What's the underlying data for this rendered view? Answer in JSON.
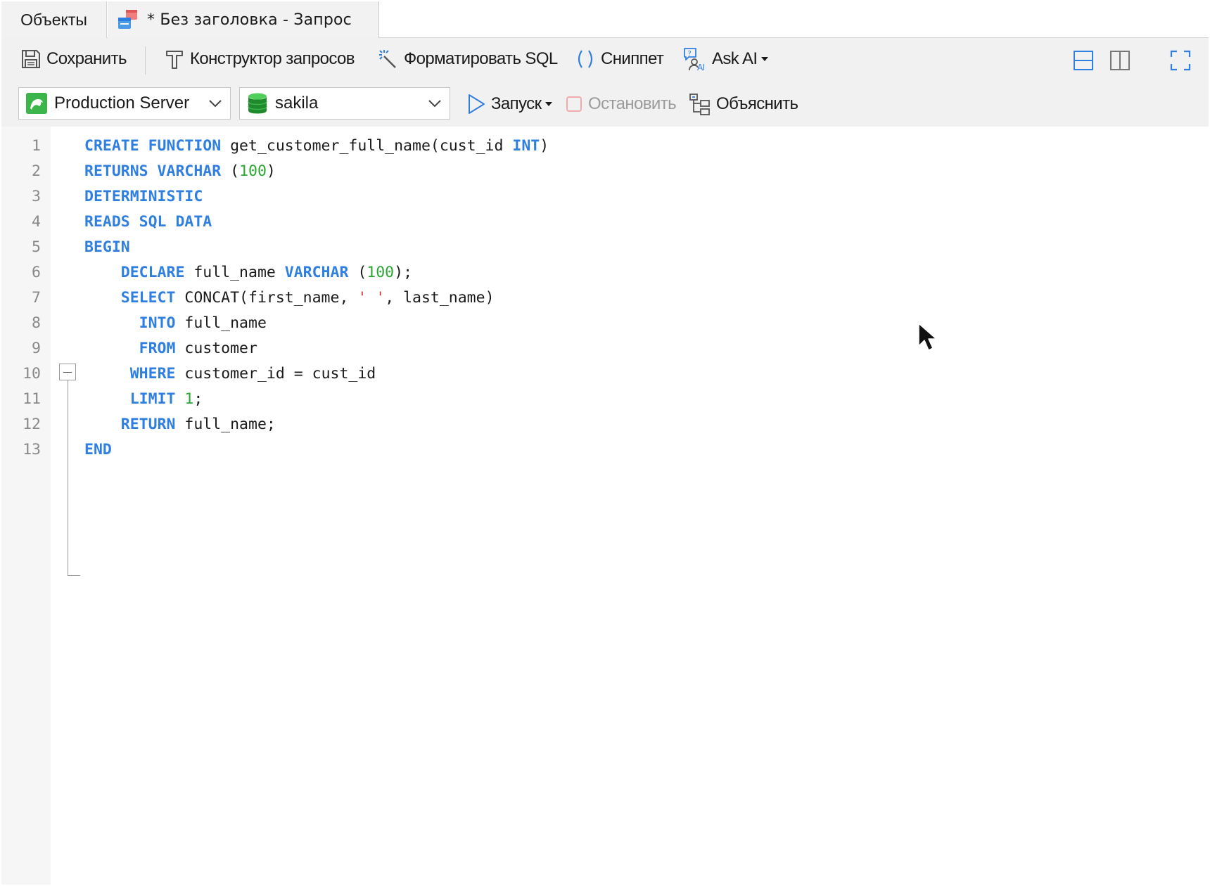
{
  "tabs": {
    "objects_label": "Объекты",
    "query_label": "* Без заголовка - Запрос"
  },
  "toolbar": {
    "save_label": "Сохранить",
    "query_builder_label": "Конструктор запросов",
    "format_sql_label": "Форматировать SQL",
    "snippet_label": "Сниппет",
    "ask_ai_label": "Ask AI",
    "run_label": "Запуск",
    "stop_label": "Остановить",
    "explain_label": "Объяснить"
  },
  "connection": {
    "selected": "Production Server"
  },
  "database": {
    "selected": "sakila"
  },
  "colors": {
    "keyword": "#2f7fe0",
    "number": "#2aa830",
    "string": "#e03a3a",
    "accent": "#2f7fe0"
  },
  "editor": {
    "line_numbers": [
      "1",
      "2",
      "3",
      "4",
      "5",
      "6",
      "7",
      "8",
      "9",
      "10",
      "11",
      "12",
      "13"
    ]
  },
  "code_lines": [
    [
      {
        "t": "CREATE FUNCTION",
        "c": "kw"
      },
      {
        "t": " get_customer_full_name(cust_id "
      },
      {
        "t": "INT",
        "c": "kw"
      },
      {
        "t": ")"
      }
    ],
    [
      {
        "t": "RETURNS VARCHAR",
        "c": "kw"
      },
      {
        "t": " ("
      },
      {
        "t": "100",
        "c": "num"
      },
      {
        "t": ")"
      }
    ],
    [
      {
        "t": "DETERMINISTIC",
        "c": "kw"
      }
    ],
    [
      {
        "t": "READS SQL DATA",
        "c": "kw"
      }
    ],
    [
      {
        "t": "BEGIN",
        "c": "kw"
      }
    ],
    [
      {
        "t": "    "
      },
      {
        "t": "DECLARE",
        "c": "kw"
      },
      {
        "t": " full_name "
      },
      {
        "t": "VARCHAR",
        "c": "kw"
      },
      {
        "t": " ("
      },
      {
        "t": "100",
        "c": "num"
      },
      {
        "t": ");"
      }
    ],
    [
      {
        "t": "    "
      },
      {
        "t": "SELECT",
        "c": "kw"
      },
      {
        "t": " CONCAT(first_name, "
      },
      {
        "t": "' '",
        "c": "str"
      },
      {
        "t": ", last_name)"
      }
    ],
    [
      {
        "t": "      "
      },
      {
        "t": "INTO",
        "c": "kw"
      },
      {
        "t": " full_name"
      }
    ],
    [
      {
        "t": "      "
      },
      {
        "t": "FROM",
        "c": "kw"
      },
      {
        "t": " customer"
      }
    ],
    [
      {
        "t": "     "
      },
      {
        "t": "WHERE",
        "c": "kw"
      },
      {
        "t": " customer_id = cust_id"
      }
    ],
    [
      {
        "t": "     "
      },
      {
        "t": "LIMIT",
        "c": "kw"
      },
      {
        "t": " "
      },
      {
        "t": "1",
        "c": "num"
      },
      {
        "t": ";"
      }
    ],
    [
      {
        "t": "    "
      },
      {
        "t": "RETURN",
        "c": "kw"
      },
      {
        "t": " full_name;"
      }
    ],
    [
      {
        "t": "END",
        "c": "kw"
      }
    ]
  ]
}
